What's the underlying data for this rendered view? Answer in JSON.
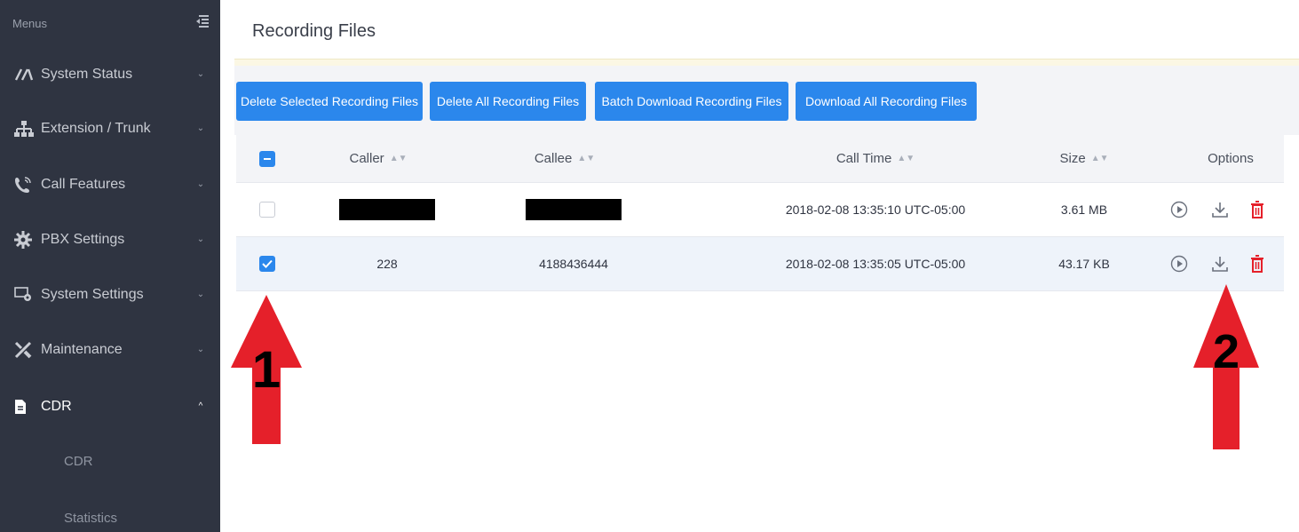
{
  "sidebar": {
    "header": "Menus",
    "items": [
      {
        "label": "System Status",
        "icon": "gauge-icon"
      },
      {
        "label": "Extension / Trunk",
        "icon": "network-icon"
      },
      {
        "label": "Call Features",
        "icon": "phone-icon"
      },
      {
        "label": "PBX Settings",
        "icon": "gear-icon"
      },
      {
        "label": "System Settings",
        "icon": "settings-window-icon"
      },
      {
        "label": "Maintenance",
        "icon": "wrench-icon"
      },
      {
        "label": "CDR",
        "icon": "document-icon"
      }
    ],
    "sub_items": [
      "CDR",
      "Statistics"
    ]
  },
  "main": {
    "title": "Recording Files",
    "buttons": [
      "Delete Selected Recording Files",
      "Delete All Recording Files",
      "Batch Download Recording Files",
      "Download All Recording Files"
    ],
    "table": {
      "headers": [
        "Caller",
        "Callee",
        "Call Time",
        "Size",
        "Options"
      ],
      "rows": [
        {
          "caller": "",
          "callee": "",
          "call_time": "2018-02-08 13:35:10 UTC-05:00",
          "size": "3.61 MB",
          "checked": false,
          "redacted": true
        },
        {
          "caller": "228",
          "callee": "4188436444",
          "call_time": "2018-02-08 13:35:05 UTC-05:00",
          "size": "43.17 KB",
          "checked": true,
          "redacted": false
        }
      ]
    }
  },
  "annotations": [
    {
      "label": "1",
      "color": "#e5202a"
    },
    {
      "label": "2",
      "color": "#e5202a"
    }
  ],
  "colors": {
    "sidebar_bg": "#2f3441",
    "accent": "#2b87ec",
    "delete_red": "#e5202a"
  }
}
